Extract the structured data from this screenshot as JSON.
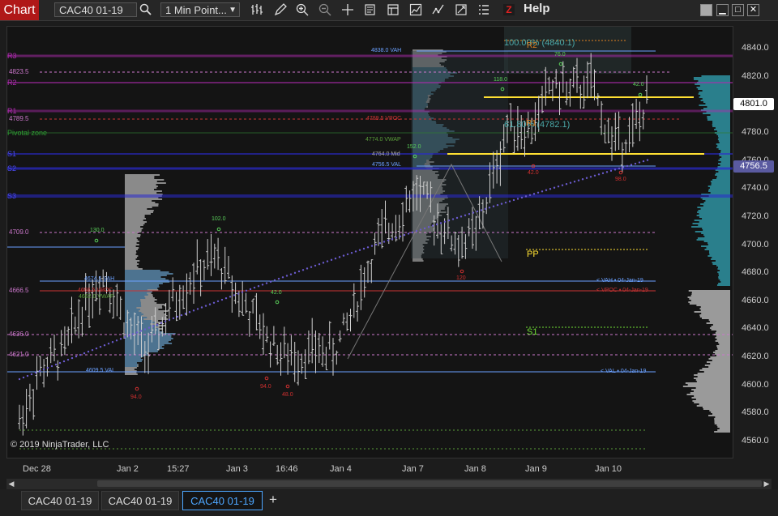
{
  "toolbar": {
    "chart_label": "Chart",
    "instrument": "CAC40 01-19",
    "interval": "1 Min Point...",
    "help": "Help",
    "z_logo": "Z",
    "icons": [
      "search-icon",
      "bar-type-icon",
      "draw-pencil-icon",
      "zoom-in-icon",
      "zoom-out-icon",
      "crosshair-icon",
      "data-box-icon",
      "properties-icon",
      "strategy-icon",
      "indicators-icon",
      "templates-icon",
      "list-icon"
    ]
  },
  "chart": {
    "copyright": "© 2019 NinjaTrader, LLC",
    "y_ticks": [
      "4840.0",
      "4820.0",
      "4800.0",
      "4780.0",
      "4760.0",
      "4740.0",
      "4720.0",
      "4700.0",
      "4680.0",
      "4660.0",
      "4640.0",
      "4620.0",
      "4600.0",
      "4580.0",
      "4560.0"
    ],
    "x_ticks": [
      "Dec 28",
      "Jan 2",
      "15:27",
      "Jan 3",
      "16:46",
      "Jan 4",
      "Jan 7",
      "Jan 8",
      "Jan 9",
      "Jan 10"
    ],
    "price_tags": [
      {
        "label": "4801.0",
        "color": "#ffffff",
        "text_color": "#000000"
      },
      {
        "label": "4756.5",
        "color": "#5a5aa0",
        "text_color": "#ffffff"
      }
    ],
    "left_labels": {
      "r3": "R3",
      "r2": "R2",
      "r1": "R1",
      "s1": "S1",
      "s2": "S2",
      "s3": "S3",
      "pivot_zone": "Pivotal zone",
      "l4823": "4823.5",
      "l4789": "4789.5",
      "l4709": "4709.0",
      "l4666": "4666.5",
      "l4636": "4636.0",
      "l4621": "4621.0"
    },
    "vp_labels": {
      "vah1": "4838.0 VAH",
      "vpoc1": "4789.5 VPOC",
      "vwap1": "4774.0 VWAP",
      "mid1": "4764.0 Mid",
      "val1": "4756.5 VAL",
      "vah2": "4674.5 VAH",
      "vpoc2": "4666.5 VPOC",
      "vwap2": "4662.0 VWAP",
      "val2": "4609.5 VAL",
      "vah_prev": "< VAH • 04-Jan-19",
      "vpoc_prev": "< VPOC • 04-Jan-19",
      "val_prev": "< VAL • 04-Jan-19"
    },
    "swing_labels": {
      "s130": "130.0",
      "s102": "102.0",
      "s42a": "42.0",
      "s152": "152.0",
      "s118": "118.0",
      "s76": "76.0",
      "s42b": "42.0",
      "s94a": "94.0",
      "s94b": "94.0",
      "s48": "48.0",
      "s42c": "42.0",
      "s98": "98.0",
      "s120": "120"
    },
    "fib_labels": {
      "r2": "R2",
      "r1": "R1",
      "pp": "PP",
      "s1": "S1",
      "pct100": "100.00% (4840.1)",
      "pct618": "61.80% (4782.1)"
    }
  },
  "tabs": [
    {
      "label": "CAC40 01-19",
      "active": false
    },
    {
      "label": "CAC40 01-19",
      "active": false
    },
    {
      "label": "CAC40 01-19",
      "active": true
    }
  ],
  "colors": {
    "accent": "#4da6ff",
    "brand_red": "#b01818",
    "pivot_magenta": "#b02ab0",
    "vah_blue": "#6aa0ff",
    "vwap_green": "#5a9e3a",
    "yellow": "#ffe033"
  }
}
